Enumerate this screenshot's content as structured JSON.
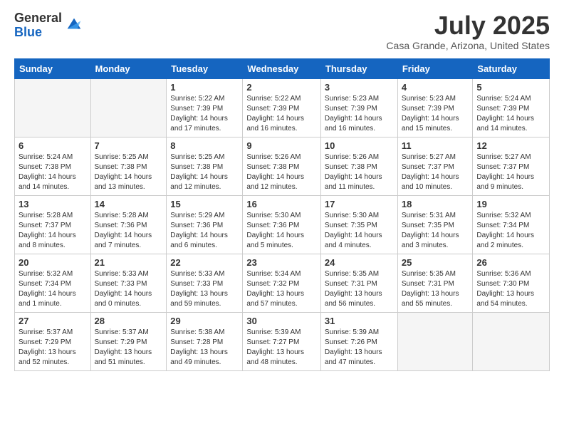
{
  "header": {
    "logo_general": "General",
    "logo_blue": "Blue",
    "month": "July 2025",
    "location": "Casa Grande, Arizona, United States"
  },
  "weekdays": [
    "Sunday",
    "Monday",
    "Tuesday",
    "Wednesday",
    "Thursday",
    "Friday",
    "Saturday"
  ],
  "weeks": [
    [
      {
        "day": "",
        "info": ""
      },
      {
        "day": "",
        "info": ""
      },
      {
        "day": "1",
        "info": "Sunrise: 5:22 AM\nSunset: 7:39 PM\nDaylight: 14 hours and 17 minutes."
      },
      {
        "day": "2",
        "info": "Sunrise: 5:22 AM\nSunset: 7:39 PM\nDaylight: 14 hours and 16 minutes."
      },
      {
        "day": "3",
        "info": "Sunrise: 5:23 AM\nSunset: 7:39 PM\nDaylight: 14 hours and 16 minutes."
      },
      {
        "day": "4",
        "info": "Sunrise: 5:23 AM\nSunset: 7:39 PM\nDaylight: 14 hours and 15 minutes."
      },
      {
        "day": "5",
        "info": "Sunrise: 5:24 AM\nSunset: 7:39 PM\nDaylight: 14 hours and 14 minutes."
      }
    ],
    [
      {
        "day": "6",
        "info": "Sunrise: 5:24 AM\nSunset: 7:38 PM\nDaylight: 14 hours and 14 minutes."
      },
      {
        "day": "7",
        "info": "Sunrise: 5:25 AM\nSunset: 7:38 PM\nDaylight: 14 hours and 13 minutes."
      },
      {
        "day": "8",
        "info": "Sunrise: 5:25 AM\nSunset: 7:38 PM\nDaylight: 14 hours and 12 minutes."
      },
      {
        "day": "9",
        "info": "Sunrise: 5:26 AM\nSunset: 7:38 PM\nDaylight: 14 hours and 12 minutes."
      },
      {
        "day": "10",
        "info": "Sunrise: 5:26 AM\nSunset: 7:38 PM\nDaylight: 14 hours and 11 minutes."
      },
      {
        "day": "11",
        "info": "Sunrise: 5:27 AM\nSunset: 7:37 PM\nDaylight: 14 hours and 10 minutes."
      },
      {
        "day": "12",
        "info": "Sunrise: 5:27 AM\nSunset: 7:37 PM\nDaylight: 14 hours and 9 minutes."
      }
    ],
    [
      {
        "day": "13",
        "info": "Sunrise: 5:28 AM\nSunset: 7:37 PM\nDaylight: 14 hours and 8 minutes."
      },
      {
        "day": "14",
        "info": "Sunrise: 5:28 AM\nSunset: 7:36 PM\nDaylight: 14 hours and 7 minutes."
      },
      {
        "day": "15",
        "info": "Sunrise: 5:29 AM\nSunset: 7:36 PM\nDaylight: 14 hours and 6 minutes."
      },
      {
        "day": "16",
        "info": "Sunrise: 5:30 AM\nSunset: 7:36 PM\nDaylight: 14 hours and 5 minutes."
      },
      {
        "day": "17",
        "info": "Sunrise: 5:30 AM\nSunset: 7:35 PM\nDaylight: 14 hours and 4 minutes."
      },
      {
        "day": "18",
        "info": "Sunrise: 5:31 AM\nSunset: 7:35 PM\nDaylight: 14 hours and 3 minutes."
      },
      {
        "day": "19",
        "info": "Sunrise: 5:32 AM\nSunset: 7:34 PM\nDaylight: 14 hours and 2 minutes."
      }
    ],
    [
      {
        "day": "20",
        "info": "Sunrise: 5:32 AM\nSunset: 7:34 PM\nDaylight: 14 hours and 1 minute."
      },
      {
        "day": "21",
        "info": "Sunrise: 5:33 AM\nSunset: 7:33 PM\nDaylight: 14 hours and 0 minutes."
      },
      {
        "day": "22",
        "info": "Sunrise: 5:33 AM\nSunset: 7:33 PM\nDaylight: 13 hours and 59 minutes."
      },
      {
        "day": "23",
        "info": "Sunrise: 5:34 AM\nSunset: 7:32 PM\nDaylight: 13 hours and 57 minutes."
      },
      {
        "day": "24",
        "info": "Sunrise: 5:35 AM\nSunset: 7:31 PM\nDaylight: 13 hours and 56 minutes."
      },
      {
        "day": "25",
        "info": "Sunrise: 5:35 AM\nSunset: 7:31 PM\nDaylight: 13 hours and 55 minutes."
      },
      {
        "day": "26",
        "info": "Sunrise: 5:36 AM\nSunset: 7:30 PM\nDaylight: 13 hours and 54 minutes."
      }
    ],
    [
      {
        "day": "27",
        "info": "Sunrise: 5:37 AM\nSunset: 7:29 PM\nDaylight: 13 hours and 52 minutes."
      },
      {
        "day": "28",
        "info": "Sunrise: 5:37 AM\nSunset: 7:29 PM\nDaylight: 13 hours and 51 minutes."
      },
      {
        "day": "29",
        "info": "Sunrise: 5:38 AM\nSunset: 7:28 PM\nDaylight: 13 hours and 49 minutes."
      },
      {
        "day": "30",
        "info": "Sunrise: 5:39 AM\nSunset: 7:27 PM\nDaylight: 13 hours and 48 minutes."
      },
      {
        "day": "31",
        "info": "Sunrise: 5:39 AM\nSunset: 7:26 PM\nDaylight: 13 hours and 47 minutes."
      },
      {
        "day": "",
        "info": ""
      },
      {
        "day": "",
        "info": ""
      }
    ]
  ]
}
